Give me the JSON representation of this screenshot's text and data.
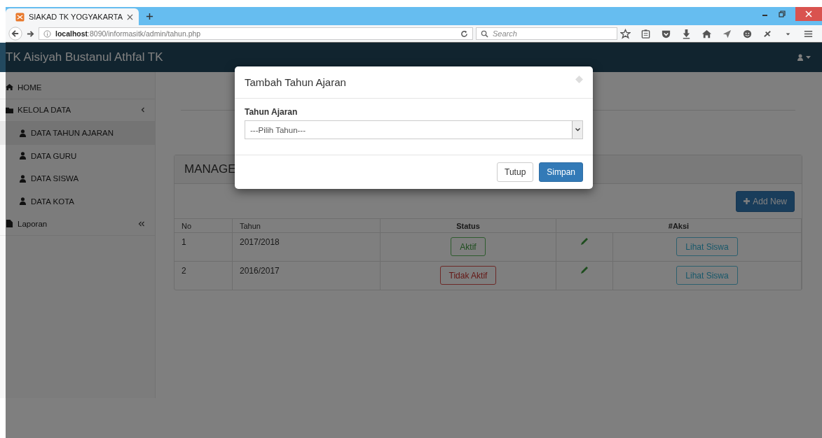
{
  "browser": {
    "tab_title": "SIAKAD TK YOGYAKARTA",
    "url_host": "localhost",
    "url_rest": ":8090/informasitk/admin/tahun.php",
    "search_placeholder": "Search"
  },
  "navbar": {
    "brand": "TK Aisiyah Bustanul Athfal TK"
  },
  "sidebar": {
    "items": [
      {
        "kind": "link",
        "label": "HOME",
        "selected": false
      },
      {
        "kind": "group",
        "label": "KELOLA DATA",
        "expanded": true,
        "children": [
          {
            "label": "DATA TAHUN AJARAN",
            "selected": true
          },
          {
            "label": "DATA GURU",
            "selected": false
          },
          {
            "label": "DATA SISWA",
            "selected": false
          },
          {
            "label": "DATA KOTA",
            "selected": false
          }
        ]
      },
      {
        "kind": "group",
        "label": "Laporan",
        "expanded": false
      }
    ]
  },
  "panel": {
    "title": "MANAGE",
    "add_button": "Add New"
  },
  "table": {
    "columns": [
      "No",
      "Tahun",
      "Status",
      "#Aksi"
    ],
    "rows": [
      {
        "no": "1",
        "tahun": "2017/2018",
        "status": {
          "label": "Aktif",
          "active": true
        },
        "action": "Lihat Siswa"
      },
      {
        "no": "2",
        "tahun": "2016/2017",
        "status": {
          "label": "Tidak Aktif",
          "active": false
        },
        "action": "Lihat Siswa"
      }
    ]
  },
  "modal": {
    "title": "Tambah Tahun Ajaran",
    "field_label": "Tahun Ajaran",
    "select_placeholder": "---Pilih Tahun---",
    "buttons": [
      {
        "kind": "default",
        "label": "Tutup"
      },
      {
        "kind": "primary",
        "label": "Simpan"
      }
    ]
  }
}
